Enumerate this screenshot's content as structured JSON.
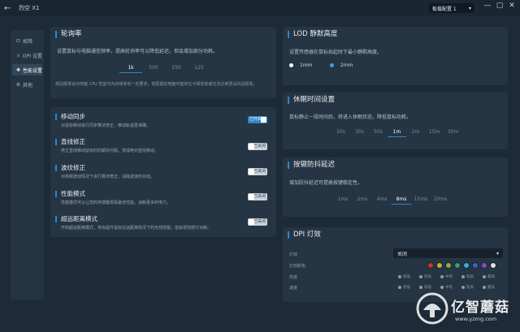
{
  "app": {
    "title": "烈空 X1",
    "back_icon": "back-arrow-icon",
    "profile": "板载配置 1"
  },
  "window_controls": [
    "—",
    "▢",
    "✕"
  ],
  "sidebar": {
    "items": [
      {
        "label": "故障",
        "icon": "report-icon"
      },
      {
        "label": "DPI 设置",
        "icon": "dpi-icon"
      },
      {
        "label": "性能设置",
        "icon": "performance-icon",
        "active": true
      },
      {
        "label": "其他",
        "icon": "other-icon"
      }
    ]
  },
  "polling": {
    "title": "轮询率",
    "desc": "设置鼠标与电脑通信频率，提高轮询率可以降低延迟，但会增加部分功耗。",
    "options": [
      "1k",
      "500",
      "250",
      "125"
    ],
    "selected": "1k",
    "note": "高回报率会对电脑 CPU 性能与内存频率有一定要求，低配置的电脑可能存在卡顿现象或无法达到预设的回报率。"
  },
  "toggles": [
    {
      "title": "移动同步",
      "desc": "对鼠标移动进行同步算法修正，移动轨迹更准确。",
      "state": "已开启",
      "on": true
    },
    {
      "title": "直线修正",
      "desc": "修正直线移动鼠标时的颤抖问题，变成绝对直线移动。",
      "state": "已关闭",
      "on": false
    },
    {
      "title": "波纹修正",
      "desc": "对高频波动情况下进行算法修正，消除波浪形抖动。",
      "state": "已关闭",
      "on": false
    },
    {
      "title": "性能模式",
      "desc": "性能模式可以让您的传感器发挥最佳性能，消耗更多的电力。",
      "state": "已关闭",
      "on": false
    },
    {
      "title": "超远距离模式",
      "desc": "开启超远距离模式，将会提升鼠标在远距离情况下的无线性能，但会增加部分功耗。",
      "state": "已关闭",
      "on": false
    }
  ],
  "lod": {
    "title": "LOD 静默高度",
    "desc": "设置传感器在鼠标抬起时下最小静默高度。",
    "options": [
      "1mm",
      "2mm"
    ],
    "selected": "2mm"
  },
  "sleep": {
    "title": "休眠时间设置",
    "desc": "鼠标静止一段时间后，将进入休眠状态，降低鼠标功耗。",
    "options": [
      "10s",
      "30s",
      "50s",
      "1m",
      "2m",
      "15m",
      "30m"
    ],
    "selected": "1m"
  },
  "debounce": {
    "title": "按键防抖延迟",
    "desc": "增加防抖延迟可提高按键稳定性。",
    "options": [
      "1ms",
      "2ms",
      "4ms",
      "8ms",
      "15ms",
      "20ms"
    ],
    "selected": "8ms"
  },
  "dpi_light": {
    "title": "DPI 灯效",
    "effect_label": "灯效",
    "effect_value": "关闭",
    "color_label": "灯效颜色",
    "colors": [
      "#c0392b",
      "#d4a93a",
      "#8fae3c",
      "#2ba37a",
      "#3ab0d8",
      "#3f5fd0",
      "#8b48c8",
      "#e0e0e0"
    ],
    "brightness_label": "亮度",
    "speed_label": "速度",
    "levels": [
      "很低",
      "较低",
      "中等",
      "较高",
      "最高"
    ]
  },
  "watermark": {
    "name": "亿智蘑菇",
    "url": "www.yzmg.com"
  }
}
